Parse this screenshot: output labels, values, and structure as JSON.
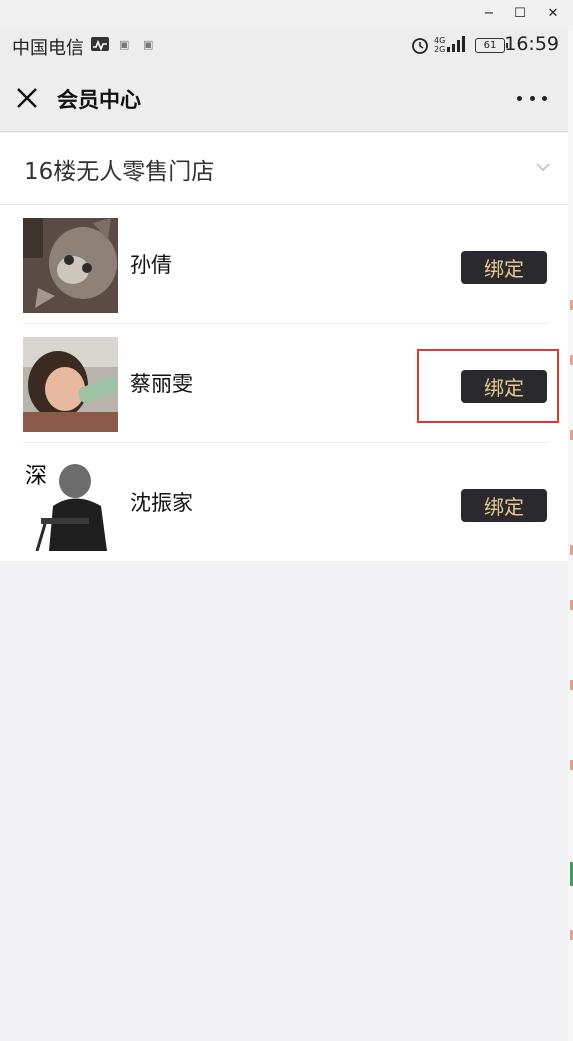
{
  "window_controls": {
    "minimize": "−",
    "maximize": "☐",
    "close": "✕"
  },
  "status_bar": {
    "carrier": "中国电信",
    "network": "4G 2G",
    "battery": "61",
    "time": "16:59"
  },
  "nav": {
    "title": "会员中心"
  },
  "store": {
    "name": "16楼无人零售门店"
  },
  "members": [
    {
      "name": "孙倩",
      "bind_label": "绑定",
      "avatar_icon": "cat-photo-avatar"
    },
    {
      "name": "蔡丽雯",
      "bind_label": "绑定",
      "avatar_icon": "child-drinking-avatar"
    },
    {
      "name": "沈振家",
      "bind_label": "绑定",
      "avatar_icon": "thinking-man-avatar",
      "avatar_text": "深 思"
    }
  ],
  "colors": {
    "bind_bg": "#2a2a2e",
    "bind_text": "#e9c98e",
    "highlight_border": "#e23a2e"
  }
}
